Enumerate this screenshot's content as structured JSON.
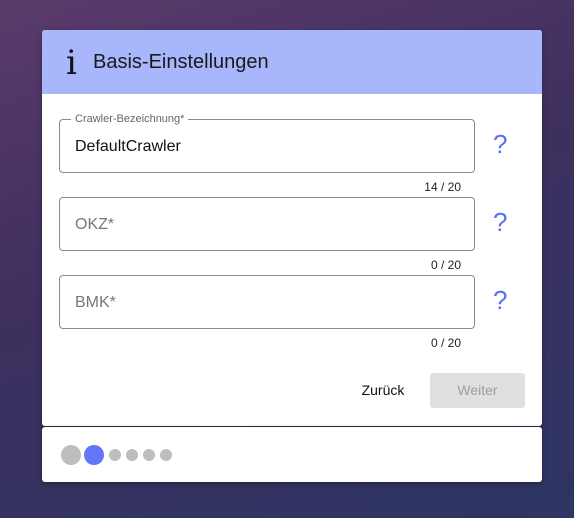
{
  "header": {
    "title": "Basis-Einstellungen",
    "icon": "info-icon",
    "icon_glyph": "i",
    "color": "#a8b6fb"
  },
  "fields": [
    {
      "label": "Crawler-Bezeichnung*",
      "value": "DefaultCrawler",
      "placeholder": "",
      "counter": "14 / 20"
    },
    {
      "label": "",
      "value": "",
      "placeholder": "OKZ*",
      "counter": "0 / 20"
    },
    {
      "label": "",
      "value": "",
      "placeholder": "BMK*",
      "counter": "0 / 20"
    }
  ],
  "help": {
    "glyph": "?",
    "color": "#5a6ef0"
  },
  "actions": {
    "back_label": "Zurück",
    "next_label": "Weiter",
    "next_disabled": true
  },
  "stepper": {
    "steps_total": 6,
    "current_step": 2,
    "active_color": "#6475f5"
  }
}
